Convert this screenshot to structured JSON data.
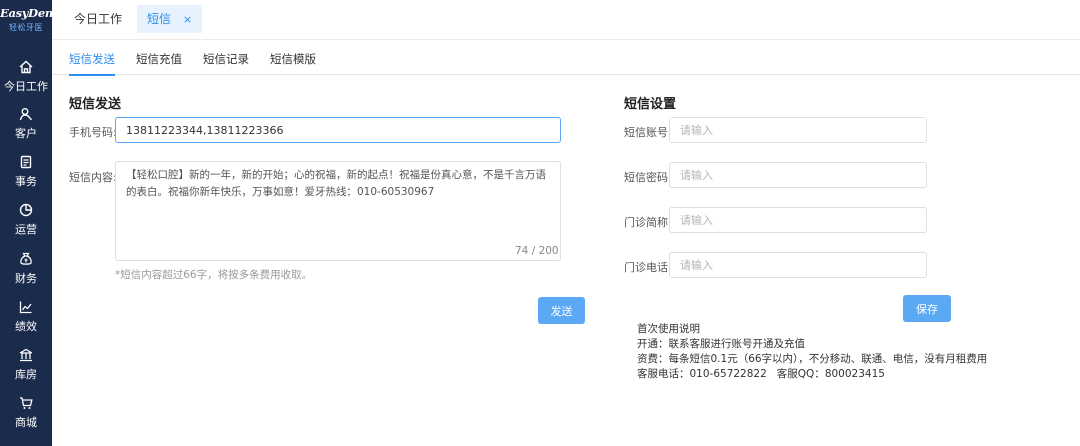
{
  "logo": {
    "main": "EasyDent",
    "sub": "轻松牙医"
  },
  "sidebar": {
    "items": [
      {
        "label": "今日工作",
        "icon": "home-icon"
      },
      {
        "label": "客户",
        "icon": "user-icon"
      },
      {
        "label": "事务",
        "icon": "clipboard-icon"
      },
      {
        "label": "运营",
        "icon": "pie-chart-icon"
      },
      {
        "label": "财务",
        "icon": "money-bag-icon"
      },
      {
        "label": "绩效",
        "icon": "line-chart-icon"
      },
      {
        "label": "库房",
        "icon": "warehouse-icon"
      },
      {
        "label": "商城",
        "icon": "cart-icon"
      }
    ]
  },
  "top_tabs": [
    {
      "label": "今日工作"
    },
    {
      "label": "短信",
      "close": "×"
    }
  ],
  "sub_tabs": [
    {
      "label": "短信发送"
    },
    {
      "label": "短信充值"
    },
    {
      "label": "短信记录"
    },
    {
      "label": "短信模版"
    }
  ],
  "send": {
    "title": "短信发送",
    "phone_label": "手机号码:",
    "phone_value": "13811223344,13811223366",
    "content_label": "短信内容:",
    "content_value": "【轻松口腔】新的一年，新的开始；心的祝福，新的起点！祝福是份真心意，不是千言万语的表白。祝福你新年快乐，万事如意！爱牙热线：010-60530967",
    "counter": "74 / 200",
    "hint": "*短信内容超过66字，将按多条费用收取。",
    "send_button": "发送"
  },
  "settings": {
    "title": "短信设置",
    "fields": [
      {
        "label": "短信账号:",
        "placeholder": "请输入"
      },
      {
        "label": "短信密码:",
        "placeholder": "请输入"
      },
      {
        "label": "门诊简称:",
        "placeholder": "请输入"
      },
      {
        "label": "门诊电话:",
        "placeholder": "请输入"
      }
    ],
    "save_button": "保存",
    "notes": [
      "首次使用说明",
      "开通：联系客服进行账号开通及充值",
      "资费：每条短信0.1元（66字以内），不分移动、联通、电信，没有月租费用",
      "客服电话：010-65722822   客服QQ：800023415"
    ]
  },
  "colors": {
    "sidebar": "#1a2b4c",
    "accent": "#2d8cf0",
    "button": "#5ba8f5"
  }
}
